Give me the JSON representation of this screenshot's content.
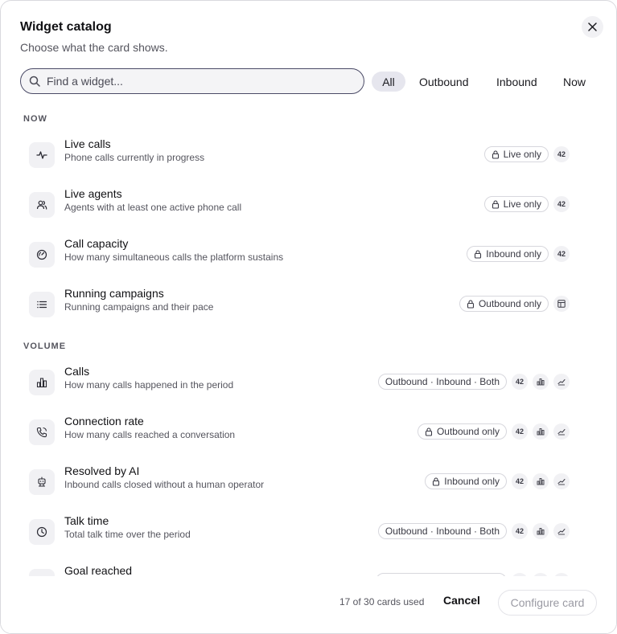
{
  "dialog": {
    "title": "Widget catalog",
    "subtitle": "Choose what the card shows."
  },
  "search": {
    "placeholder": "Find a widget..."
  },
  "filters": [
    "All",
    "Outbound",
    "Inbound",
    "Now"
  ],
  "filters_active": "All",
  "sections": {
    "now": "NOW",
    "volume": "VOLUME"
  },
  "widgets": [
    {
      "name": "Live calls",
      "description": "Phone calls currently in progress",
      "icon": "activity-icon",
      "tag": "Live only",
      "locked": true,
      "badges": [
        "42"
      ]
    },
    {
      "name": "Live agents",
      "description": "Agents with at least one active phone call",
      "icon": "users-icon",
      "tag": "Live only",
      "locked": true,
      "badges": [
        "42"
      ]
    },
    {
      "name": "Call capacity",
      "description": "How many simultaneous calls the platform sustains",
      "icon": "gauge-icon",
      "tag": "Inbound only",
      "locked": true,
      "badges": [
        "42"
      ]
    },
    {
      "name": "Running campaigns",
      "description": "Running campaigns and their pace",
      "icon": "list-icon",
      "tag": "Outbound only",
      "locked": true,
      "badges": [
        "table-icon"
      ]
    },
    {
      "name": "Calls",
      "description": "How many calls happened in the period",
      "icon": "bar-chart-icon",
      "tag": "Outbound · Inbound · Both",
      "locked": false,
      "badges": [
        "42",
        "bar-chart-icon",
        "line-chart-icon"
      ]
    },
    {
      "name": "Connection rate",
      "description": "How many calls reached a conversation",
      "icon": "phone-icon",
      "tag": "Outbound only",
      "locked": true,
      "badges": [
        "42",
        "bar-chart-icon",
        "line-chart-icon"
      ]
    },
    {
      "name": "Resolved by AI",
      "description": "Inbound calls closed without a human operator",
      "icon": "robot-icon",
      "tag": "Inbound only",
      "locked": true,
      "badges": [
        "42",
        "bar-chart-icon",
        "line-chart-icon"
      ]
    },
    {
      "name": "Talk time",
      "description": "Total talk time over the period",
      "icon": "clock-icon",
      "tag": "Outbound · Inbound · Both",
      "locked": false,
      "badges": [
        "42",
        "bar-chart-icon",
        "line-chart-icon"
      ]
    },
    {
      "name": "Goal reached",
      "description": "",
      "icon": "target-icon",
      "tag": "",
      "locked": false,
      "badges": []
    }
  ],
  "footer": {
    "usage": "17 of 30 cards used",
    "cancel_label": "Cancel",
    "configure_label": "Configure card"
  },
  "colors": {
    "accent_border": "#4a4a66",
    "chip_bg": "#f1f1f4",
    "text_muted": "#55555e"
  }
}
